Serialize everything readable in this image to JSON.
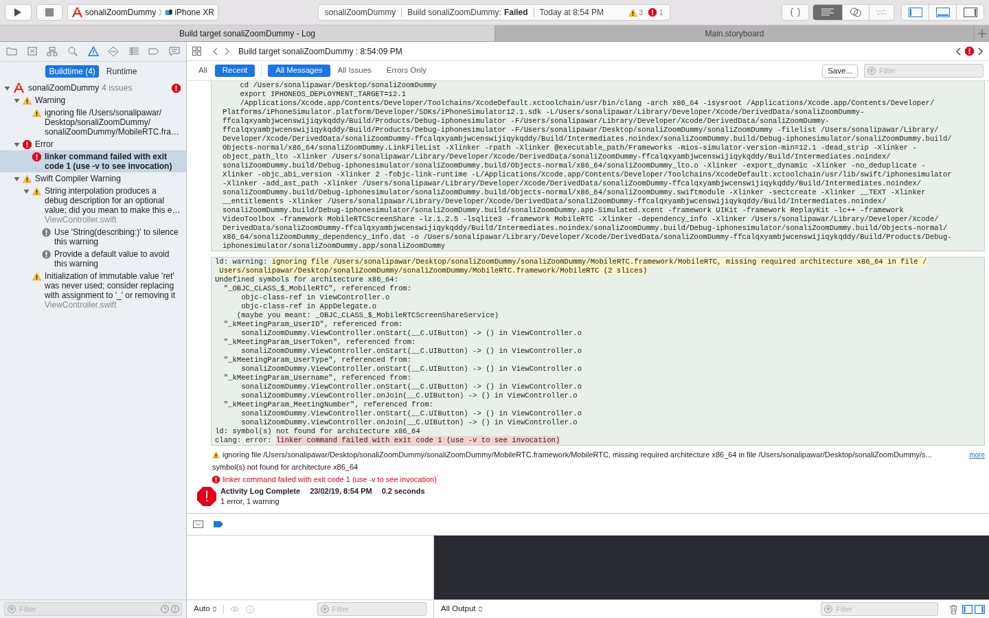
{
  "toolbar": {
    "scheme": "sonaliZoomDummy",
    "device": "iPhone XR",
    "activity": {
      "project": "sonaliZoomDummy",
      "status_label": "Build sonaliZoomDummy:",
      "status": "Failed",
      "time": "Today at 8:54 PM",
      "warnings": "3",
      "errors": "1"
    }
  },
  "tabs": [
    {
      "label": "Build target sonaliZoomDummy - Log",
      "selected": true
    },
    {
      "label": "Main.storyboard",
      "selected": false
    }
  ],
  "navigator": {
    "scope_tabs": [
      {
        "label": "Buildtime (4)",
        "selected": true
      },
      {
        "label": "Runtime",
        "selected": false
      }
    ],
    "tree": [
      {
        "kind": "project",
        "label": "sonaliZoomDummy",
        "count": "4 issues",
        "error_badge": true,
        "expanded": true,
        "selected": false,
        "children": [
          {
            "kind": "warning",
            "label": "Warning",
            "expanded": true,
            "selected": false,
            "children": [
              {
                "kind": "warning",
                "label": "ignoring file /Users/sonalipawar/Desktop/sonaliZoomDummy/sonaliZoomDummy/MobileRTC.fra…",
                "selected": false
              }
            ]
          },
          {
            "kind": "error",
            "label": "Error",
            "expanded": true,
            "selected": false,
            "children": [
              {
                "kind": "error",
                "label": "linker command failed with exit code 1 (use -v to see invocation)",
                "selected": true
              }
            ]
          },
          {
            "kind": "warning",
            "label": "Swift Compiler Warning",
            "expanded": true,
            "selected": false,
            "children": [
              {
                "kind": "warning",
                "label": "String interpolation produces a debug description for an optional value; did you mean to make this e…",
                "file": "ViewController.swift",
                "expanded": true,
                "selected": false,
                "children": [
                  {
                    "kind": "note",
                    "label": "Use 'String(describing:)' to silence this warning",
                    "selected": false
                  },
                  {
                    "kind": "note",
                    "label": "Provide a default value to avoid this warning",
                    "selected": false
                  }
                ]
              },
              {
                "kind": "warning",
                "label": "Initialization of immutable value 'ret' was never used; consider replacing with assignment to '_' or removing it",
                "file": "ViewController.swift",
                "selected": false
              }
            ]
          }
        ]
      }
    ],
    "filter_placeholder": "Filter"
  },
  "jump_bar": {
    "title": "Build target sonaliZoomDummy : 8:54:09 PM"
  },
  "log_filters": {
    "scope": [
      {
        "label": "All",
        "selected": false
      },
      {
        "label": "Recent",
        "selected": true
      }
    ],
    "messages": [
      {
        "label": "All Messages",
        "selected": true
      },
      {
        "label": "All Issues",
        "selected": false
      },
      {
        "label": "Errors Only",
        "selected": false
      }
    ],
    "save": "Save...",
    "filter_placeholder": "Filter"
  },
  "log": {
    "command_lines": [
      "    cd /Users/sonalipawar/Desktop/sonaliZoomDummy",
      "    export IPHONEOS_DEPLOYMENT_TARGET=12.1",
      "    /Applications/Xcode.app/Contents/Developer/Toolchains/XcodeDefault.xctoolchain/usr/bin/clang -arch x86_64 -isysroot /Applications/Xcode.app/Contents/Developer/",
      "Platforms/iPhoneSimulator.platform/Developer/SDKs/iPhoneSimulator12.1.sdk -L/Users/sonalipawar/Library/Developer/Xcode/DerivedData/sonaliZoomDummy-",
      "ffcalqxyambjwcenswijiqykqddy/Build/Products/Debug-iphonesimulator -F/Users/sonalipawar/Library/Developer/Xcode/DerivedData/sonaliZoomDummy-",
      "ffcalqxyambjwcenswijiqykqddy/Build/Products/Debug-iphonesimulator -F/Users/sonalipawar/Desktop/sonaliZoomDummy/sonaliZoomDummy -filelist /Users/sonalipawar/Library/",
      "Developer/Xcode/DerivedData/sonaliZoomDummy-ffcalqxyambjwcenswijiqykqddy/Build/Intermediates.noindex/sonaliZoomDummy.build/Debug-iphonesimulator/sonaliZoomDummy.build/",
      "Objects-normal/x86_64/sonaliZoomDummy.LinkFileList -Xlinker -rpath -Xlinker @executable_path/Frameworks -mios-simulator-version-min=12.1 -dead_strip -Xlinker -",
      "object_path_lto -Xlinker /Users/sonalipawar/Library/Developer/Xcode/DerivedData/sonaliZoomDummy-ffcalqxyambjwcenswijiqykqddy/Build/Intermediates.noindex/",
      "sonaliZoomDummy.build/Debug-iphonesimulator/sonaliZoomDummy.build/Objects-normal/x86_64/sonaliZoomDummy_lto.o -Xlinker -export_dynamic -Xlinker -no_deduplicate -",
      "Xlinker -objc_abi_version -Xlinker 2 -fobjc-link-runtime -L/Applications/Xcode.app/Contents/Developer/Toolchains/XcodeDefault.xctoolchain/usr/lib/swift/iphonesimulator",
      "-Xlinker -add_ast_path -Xlinker /Users/sonalipawar/Library/Developer/Xcode/DerivedData/sonaliZoomDummy-ffcalqxyambjwcenswijiqykqddy/Build/Intermediates.noindex/",
      "sonaliZoomDummy.build/Debug-iphonesimulator/sonaliZoomDummy.build/Objects-normal/x86_64/sonaliZoomDummy.swiftmodule -Xlinker -sectcreate -Xlinker __TEXT -Xlinker",
      "__entitlements -Xlinker /Users/sonalipawar/Library/Developer/Xcode/DerivedData/sonaliZoomDummy-ffcalqxyambjwcenswijiqykqddy/Build/Intermediates.noindex/",
      "sonaliZoomDummy.build/Debug-iphonesimulator/sonaliZoomDummy.build/sonaliZoomDummy.app-Simulated.xcent -framework UIKit -framework ReplayKit -lc++ -framework",
      "VideoToolbox -framework MobileRTCScreenShare -lz.1.2.5 -lsqlite3 -framework MobileRTC -Xlinker -dependency_info -Xlinker /Users/sonalipawar/Library/Developer/Xcode/",
      "DerivedData/sonaliZoomDummy-ffcalqxyambjwcenswijiqykqddy/Build/Intermediates.noindex/sonaliZoomDummy.build/Debug-iphonesimulator/sonaliZoomDummy.build/Objects-normal/",
      "x86_64/sonaliZoomDummy_dependency_info.dat -o /Users/sonalipawar/Library/Developer/Xcode/DerivedData/sonaliZoomDummy-ffcalqxyambjwcenswijiqykqddy/Build/Products/Debug-",
      "iphonesimulator/sonaliZoomDummy.app/sonaliZoomDummy"
    ],
    "output_lines": [
      {
        "prefix": "ld: warning: ",
        "text": "ignoring file /Users/sonalipawar/Desktop/sonaliZoomDummy/sonaliZoomDummy/MobileRTC.framework/MobileRTC, missing required architecture x86_64 in file /",
        "kind": "warning"
      },
      {
        "text": "Users/sonalipawar/Desktop/sonaliZoomDummy/sonaliZoomDummy/MobileRTC.framework/MobileRTC (2 slices)",
        "kind": "warning"
      },
      {
        "text": "Undefined symbols for architecture x86_64:",
        "kind": "plain"
      },
      {
        "text": "  \"_OBJC_CLASS_$_MobileRTC\", referenced from:",
        "kind": "plain"
      },
      {
        "text": "      objc-class-ref in ViewController.o",
        "kind": "plain"
      },
      {
        "text": "      objc-class-ref in AppDelegate.o",
        "kind": "plain"
      },
      {
        "text": "     (maybe you meant: _OBJC_CLASS_$_MobileRTCScreenShareService)",
        "kind": "plain"
      },
      {
        "text": "  \"_kMeetingParam_UserID\", referenced from:",
        "kind": "plain"
      },
      {
        "text": "      sonaliZoomDummy.ViewController.onStart(__C.UIButton) -> () in ViewController.o",
        "kind": "plain"
      },
      {
        "text": "  \"_kMeetingParam_UserToken\", referenced from:",
        "kind": "plain"
      },
      {
        "text": "      sonaliZoomDummy.ViewController.onStart(__C.UIButton) -> () in ViewController.o",
        "kind": "plain"
      },
      {
        "text": "  \"_kMeetingParam_UserType\", referenced from:",
        "kind": "plain"
      },
      {
        "text": "      sonaliZoomDummy.ViewController.onStart(__C.UIButton) -> () in ViewController.o",
        "kind": "plain"
      },
      {
        "text": "  \"_kMeetingParam_Username\", referenced from:",
        "kind": "plain"
      },
      {
        "text": "      sonaliZoomDummy.ViewController.onStart(__C.UIButton) -> () in ViewController.o",
        "kind": "plain"
      },
      {
        "text": "      sonaliZoomDummy.ViewController.onJoin(__C.UIButton) -> () in ViewController.o",
        "kind": "plain"
      },
      {
        "text": "  \"_kMeetingParam_MeetingNumber\", referenced from:",
        "kind": "plain"
      },
      {
        "text": "      sonaliZoomDummy.ViewController.onStart(__C.UIButton) -> () in ViewController.o",
        "kind": "plain"
      },
      {
        "text": "      sonaliZoomDummy.ViewController.onJoin(__C.UIButton) -> () in ViewController.o",
        "kind": "plain"
      },
      {
        "text": "ld: symbol(s) not found for architecture x86_64",
        "kind": "plain"
      },
      {
        "prefix": "clang: error: ",
        "text": "linker command failed with exit code 1 (use -v to see invocation)",
        "kind": "error"
      }
    ],
    "summary": [
      {
        "kind": "warning",
        "text": "ignoring file /Users/sonalipawar/Desktop/sonaliZoomDummy/sonaliZoomDummy/MobileRTC.framework/MobileRTC, missing required architecture x86_64 in file /Users/sonalipawar/Desktop/sonaliZoomDummy/s...",
        "more": "more"
      },
      {
        "kind": "plain",
        "text": "symbol(s) not found for architecture x86_64"
      },
      {
        "kind": "error",
        "text": "linker command failed with exit code 1 (use -v to see invocation)"
      }
    ],
    "complete": {
      "title": "Activity Log Complete",
      "date": "23/02/19, 8:54 PM",
      "duration": "0.2 seconds",
      "detail": "1 error, 1 warning"
    }
  },
  "debug_area": {
    "variables_mode": "Auto",
    "variables_filter_placeholder": "Filter",
    "output_mode": "All Output",
    "console_filter_placeholder": "Filter"
  }
}
